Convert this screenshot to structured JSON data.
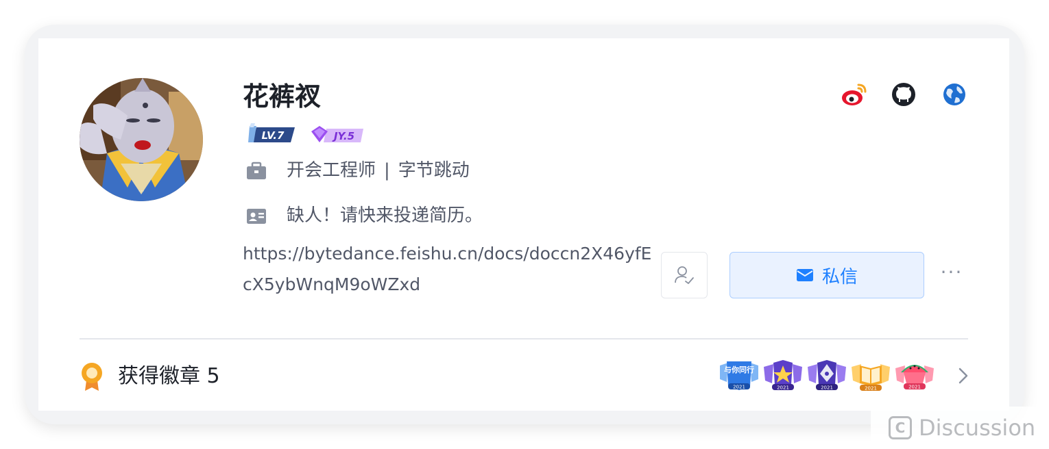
{
  "profile": {
    "username": "花裤衩",
    "level_badge": "LV.7",
    "jy_badge": "JY.5",
    "job": {
      "title": "开会工程师",
      "separator": "|",
      "company": "字节跳动"
    },
    "bio": "缺人！请快来投递简历。",
    "link": "https://bytedance.feishu.cn/docs/doccn2X46yfEcX5ybWnqM9oWZxd"
  },
  "social": [
    {
      "icon": "weibo-icon"
    },
    {
      "icon": "github-icon"
    },
    {
      "icon": "globe-icon"
    }
  ],
  "actions": {
    "message_label": "私信",
    "more_label": "···"
  },
  "badges": {
    "label": "获得徽章 5",
    "items": [
      {
        "icon": "badge-yu-ni-tong-xing",
        "text": "与你同行",
        "year": "2021"
      },
      {
        "icon": "badge-star-crown",
        "year": "2021"
      },
      {
        "icon": "badge-pen-nib",
        "year": "2021"
      },
      {
        "icon": "badge-open-book",
        "year": "2021"
      },
      {
        "icon": "badge-watermelon",
        "year": "2021"
      }
    ]
  },
  "watermark": {
    "text": "Discussion",
    "icon_letter": "C"
  },
  "colors": {
    "accent": "#1e80ff",
    "accent_bg": "#eaf2ff",
    "text_secondary": "#515767",
    "frame": "#f2f3f5"
  }
}
